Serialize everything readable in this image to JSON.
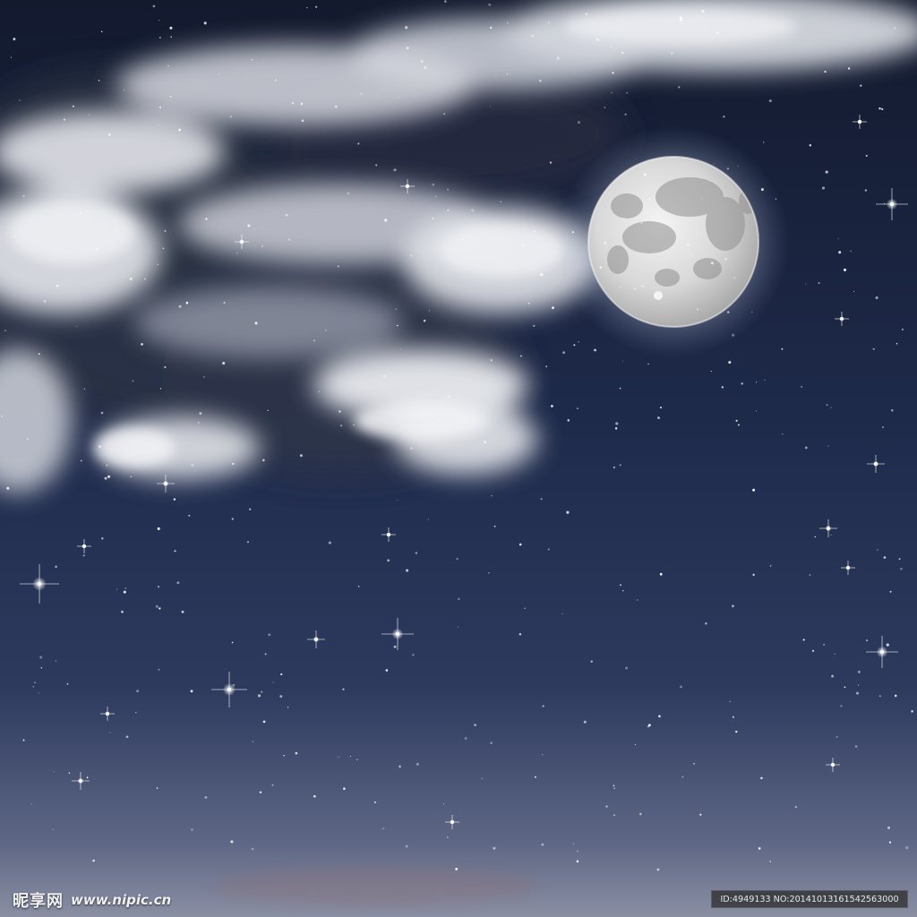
{
  "scene": {
    "description_tag": "night-sky-full-moon",
    "colors": {
      "sky_top": "#141b30",
      "sky_mid": "#233157",
      "sky_bottom": "#7f87a0",
      "cloud": "#e7e9ee",
      "moon": "#d9d9d9"
    }
  },
  "watermark": {
    "logo": "昵享网",
    "url": "www.nipic.cn"
  },
  "id_badge": {
    "text": "ID:4949133 NO:20141013161542563000"
  }
}
